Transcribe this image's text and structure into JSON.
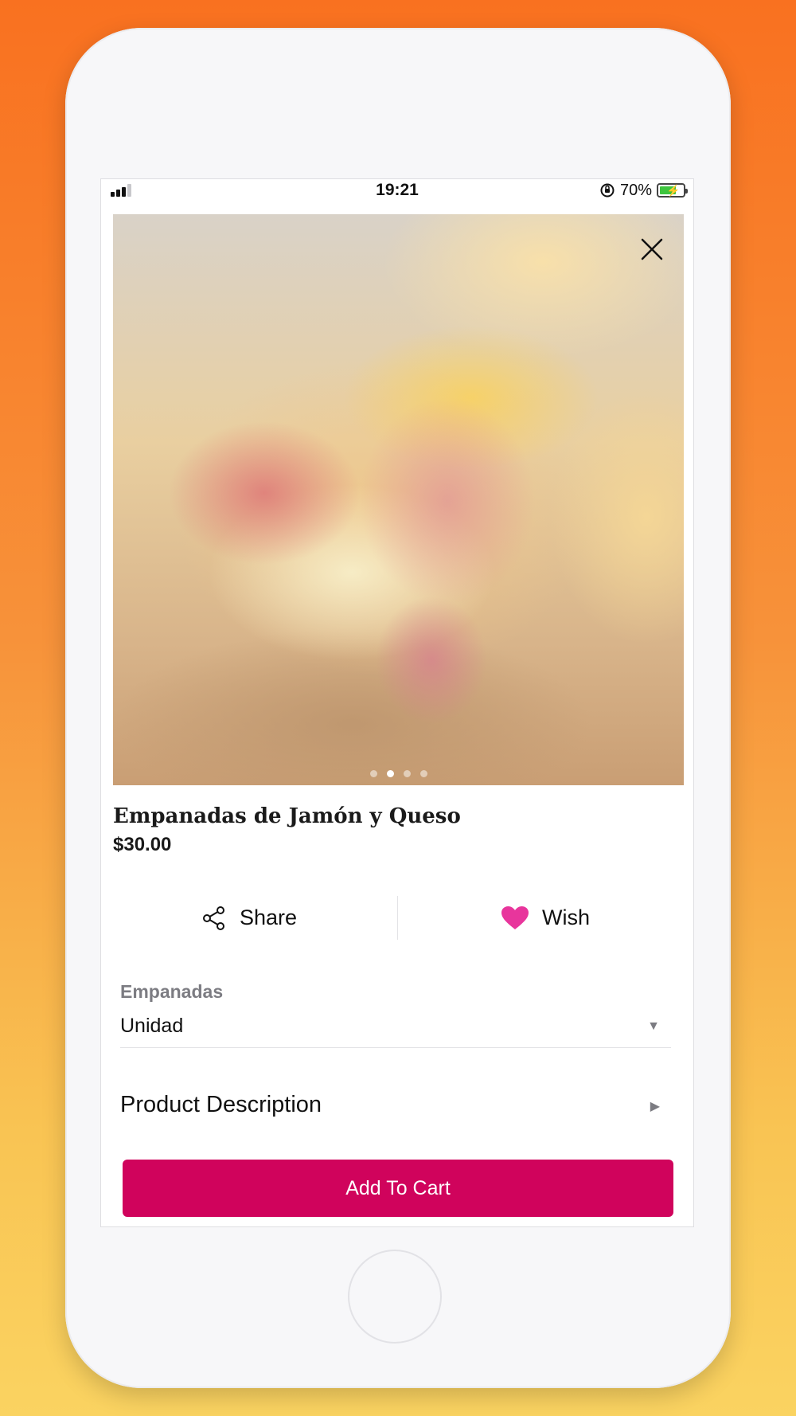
{
  "status_bar": {
    "time": "19:21",
    "battery_percent": "70%",
    "battery_level": 0.7,
    "icons": [
      "signal-icon",
      "orientation-lock-icon",
      "battery-charging-icon"
    ]
  },
  "product": {
    "title": "Empanadas de Jamón y Queso",
    "price": "$30.00",
    "image_count": 4,
    "active_image_index": 1
  },
  "actions": {
    "share_label": "Share",
    "wish_label": "Wish",
    "wish_color": "#e8359c"
  },
  "variant": {
    "label": "Empanadas",
    "selected": "Unidad"
  },
  "description": {
    "label": "Product Description"
  },
  "cart": {
    "button_label": "Add To Cart",
    "button_color": "#d0035c"
  }
}
